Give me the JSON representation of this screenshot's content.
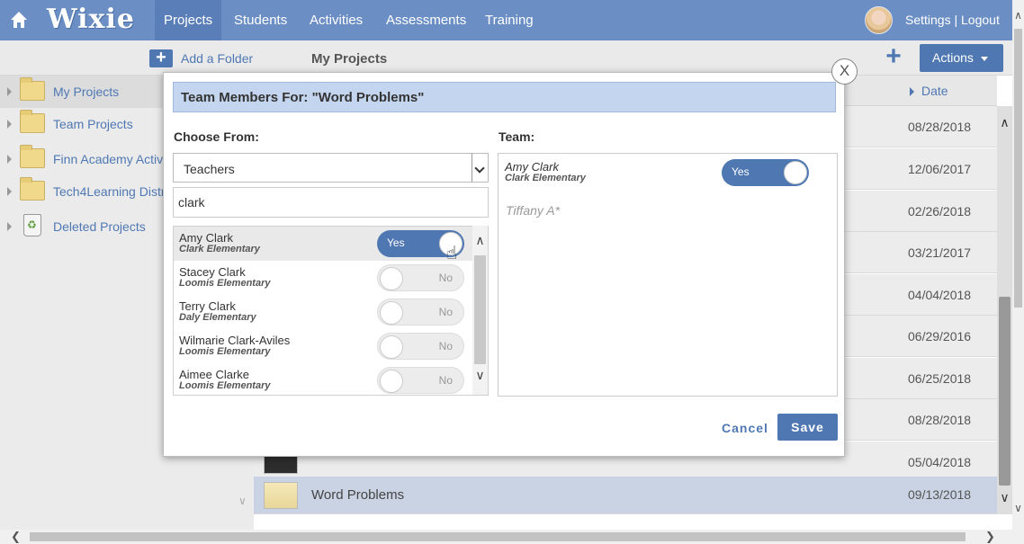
{
  "nav": {
    "logo": "Wixie",
    "items": [
      "Projects",
      "Students",
      "Activities",
      "Assessments",
      "Training"
    ],
    "active_item": "Projects",
    "settings_label": "Settings",
    "separator": "|",
    "logout_label": "Logout"
  },
  "toolbar": {
    "add_folder_label": "Add a Folder",
    "title": "My Projects",
    "plus_label": "+",
    "actions_label": "Actions"
  },
  "sidebar": {
    "items": [
      {
        "label": "My Projects",
        "icon": "folder-icon",
        "selected": true
      },
      {
        "label": "Team Projects",
        "icon": "folder-icon",
        "selected": false
      },
      {
        "label": "Finn Academy Activi",
        "icon": "folder-icon",
        "selected": false
      },
      {
        "label": "Tech4Learning Distr",
        "icon": "folder-icon",
        "selected": false
      },
      {
        "label": "Deleted Projects",
        "icon": "trash-icon",
        "selected": false
      }
    ]
  },
  "list": {
    "date_header": "Date",
    "rows": [
      {
        "date": "08/28/2018",
        "name": ""
      },
      {
        "date": "12/06/2017",
        "name": ""
      },
      {
        "date": "02/26/2018",
        "name": ""
      },
      {
        "date": "03/21/2017",
        "name": ""
      },
      {
        "date": "04/04/2018",
        "name": ""
      },
      {
        "date": "06/29/2016",
        "name": ""
      },
      {
        "date": "06/25/2018",
        "name": ""
      },
      {
        "date": "08/28/2018",
        "name": ""
      },
      {
        "date": "05/04/2018",
        "name": ""
      },
      {
        "date": "09/13/2018",
        "name": "Word Problems"
      }
    ]
  },
  "modal": {
    "close_label": "X",
    "title": "Team Members For: \"Word Problems\"",
    "choose_from_label": "Choose From:",
    "team_label": "Team:",
    "role_selected": "Teachers",
    "search_value": "clark",
    "people": [
      {
        "name": "Amy Clark",
        "school": "Clark Elementary",
        "toggle": "Yes"
      },
      {
        "name": "Stacey Clark",
        "school": "Loomis Elementary",
        "toggle": "No"
      },
      {
        "name": "Terry Clark",
        "school": "Daly Elementary",
        "toggle": "No"
      },
      {
        "name": "Wilmarie Clark-Aviles",
        "school": "Loomis Elementary",
        "toggle": "No"
      },
      {
        "name": "Aimee Clarke",
        "school": "Loomis Elementary",
        "toggle": "No"
      }
    ],
    "team": {
      "member_name": "Amy Clark",
      "member_school": "Clark Elementary",
      "member_toggle": "Yes",
      "pending": "Tiffany A*"
    },
    "cancel_label": "Cancel",
    "save_label": "Save"
  },
  "colors": {
    "nav_bg": "#6b8fc4",
    "accent": "#4f78b3",
    "title_bar": "#c4d6ef"
  }
}
